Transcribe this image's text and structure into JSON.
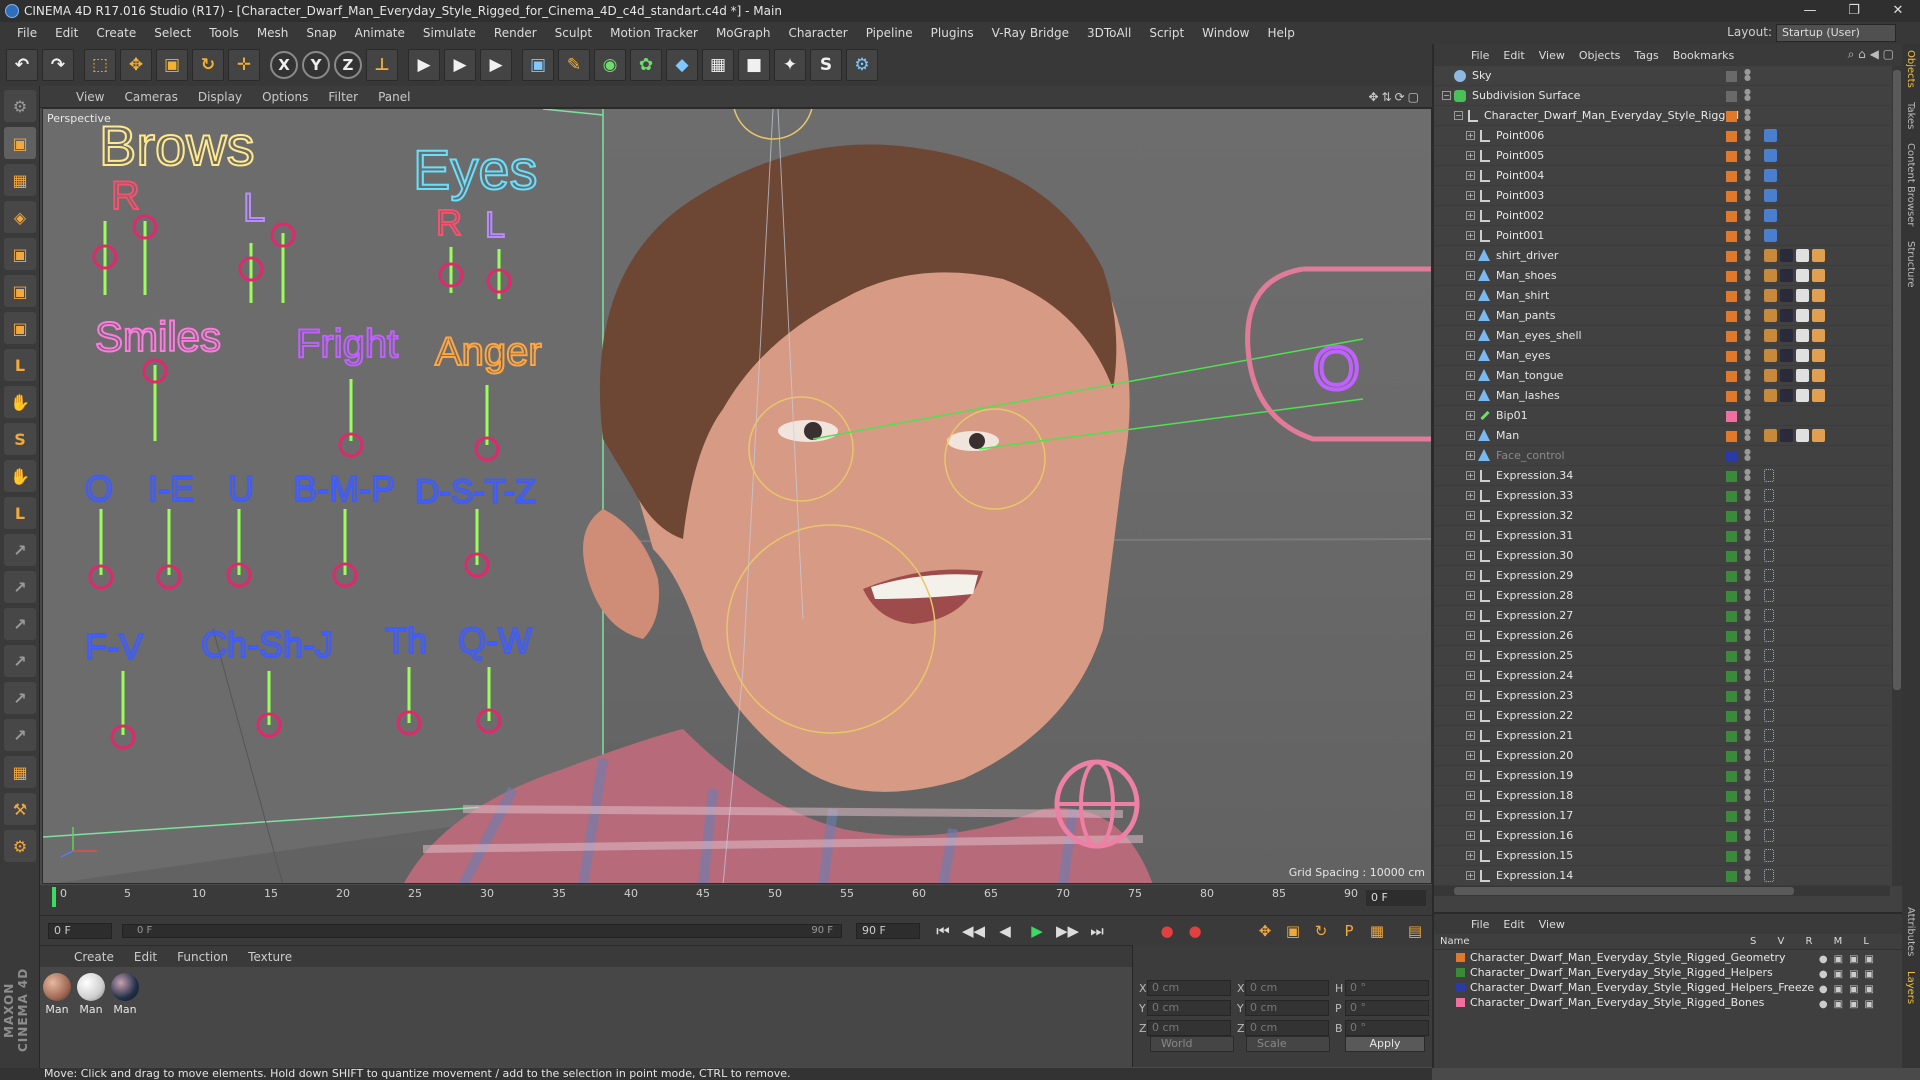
{
  "window": {
    "title": "CINEMA 4D R17.016 Studio (R17) - [Character_Dwarf_Man_Everyday_Style_Rigged_for_Cinema_4D_c4d_standart.c4d *] - Main",
    "controls": [
      "—",
      "❐",
      "✕"
    ]
  },
  "menu": [
    "File",
    "Edit",
    "Create",
    "Select",
    "Tools",
    "Mesh",
    "Snap",
    "Animate",
    "Simulate",
    "Render",
    "Sculpt",
    "Motion Tracker",
    "MoGraph",
    "Character",
    "Pipeline",
    "Plugins",
    "V-Ray Bridge",
    "3DToAll",
    "Script",
    "Window",
    "Help"
  ],
  "layout": {
    "label": "Layout:",
    "value": "Startup (User)"
  },
  "toolbar": {
    "undo": "↶",
    "redo": "↷",
    "select": "⬚",
    "move": "✥",
    "scale": "▣",
    "rotate": "↻",
    "move2": "✛",
    "axis_x": "X",
    "axis_y": "Y",
    "axis_z": "Z",
    "coord": "⊥",
    "render1": "▶",
    "render2": "▶",
    "render3": "▶",
    "cube": "▣",
    "pen": "✎",
    "nurbs": "◉",
    "array": "✿",
    "deform": "◆",
    "scene": "▦",
    "camera": "■",
    "light": "✦",
    "vray": "S",
    "python": "⚙"
  },
  "left_tools": [
    "⚙",
    "▣",
    "▦",
    "◈",
    "▣",
    "▣",
    "▣",
    "L",
    "✋",
    "S",
    "✋",
    "L",
    "↗",
    "↗",
    "↗",
    "↗",
    "↗",
    "↗",
    "▦",
    "⚒",
    "⚙"
  ],
  "viewport": {
    "menu": [
      "View",
      "Cameras",
      "Display",
      "Options",
      "Filter",
      "Panel"
    ],
    "label": "Perspective",
    "grid_spacing": "Grid Spacing : 10000 cm",
    "panel_labels": {
      "brows": "Brows",
      "eyes": "Eyes",
      "r1": "R",
      "l1": "L",
      "r2": "R",
      "l2": "L",
      "smiles": "Smiles",
      "fright": "Fright",
      "anger": "Anger",
      "o": "O",
      "ie": "I-E",
      "u": "U",
      "bmp": "B-M-P",
      "dstz": "D-S-T-Z",
      "fv": "F-V",
      "chshj": "Ch-Sh-J",
      "th": "Th",
      "qw": "Q-W",
      "eye_target": "O"
    },
    "colors": {
      "brows": "#ffe98a",
      "eyes": "#66e0ff",
      "r": "#ff4d6d",
      "l": "#b88cff",
      "smiles": "#ff7ae0",
      "fright": "#c060ff",
      "anger": "#ffa640",
      "viseme": "#3d5bff",
      "slider": "#9aff5a",
      "ring": "#e0286d"
    }
  },
  "timeline": {
    "ticks": [
      "0",
      "5",
      "10",
      "15",
      "20",
      "25",
      "30",
      "35",
      "40",
      "45",
      "50",
      "55",
      "60",
      "65",
      "70",
      "75",
      "80",
      "85",
      "90"
    ],
    "current_frame": "0 F",
    "start": "0 F",
    "slider_start": "0 F",
    "slider_end": "90 F",
    "end": "90 F"
  },
  "playback": [
    "⏮",
    "◀◀",
    "◀",
    "▶",
    "▶▶",
    "⏭"
  ],
  "materials": {
    "menu": [
      "Create",
      "Edit",
      "Function",
      "Texture"
    ],
    "items": [
      {
        "label": "Man",
        "color": "#a06a55"
      },
      {
        "label": "Man",
        "color": "#cfcfcf"
      },
      {
        "label": "Man",
        "color": "#22304a"
      }
    ]
  },
  "coordinates": {
    "pos": [
      {
        "axis": "X",
        "value": "0 cm"
      },
      {
        "axis": "Y",
        "value": "0 cm"
      },
      {
        "axis": "Z",
        "value": "0 cm"
      }
    ],
    "size": [
      {
        "axis": "X",
        "value": "0 cm"
      },
      {
        "axis": "Y",
        "value": "0 cm"
      },
      {
        "axis": "Z",
        "value": "0 cm"
      }
    ],
    "rot": [
      {
        "axis": "H",
        "value": "0 °"
      },
      {
        "axis": "P",
        "value": "0 °"
      },
      {
        "axis": "B",
        "value": "0 °"
      }
    ],
    "mode1": "World",
    "mode2": "Scale",
    "apply": "Apply"
  },
  "status": "Move: Click and drag to move elements. Hold down SHIFT to quantize movement / add to the selection in point mode, CTRL to remove.",
  "objects": {
    "menu": [
      "File",
      "Edit",
      "View",
      "Objects",
      "Tags",
      "Bookmarks"
    ],
    "rows": [
      {
        "name": "Sky",
        "indent": 0,
        "type": "sky",
        "layer": "",
        "tags": ""
      },
      {
        "name": "Subdivision Surface",
        "indent": 0,
        "type": "subd",
        "layer": "",
        "tags": ""
      },
      {
        "name": "Character_Dwarf_Man_Everyday_Style_Rigged",
        "indent": 1,
        "type": "null",
        "layer": "#e07a2a",
        "tags": ""
      },
      {
        "name": "Point006",
        "indent": 2,
        "type": "null",
        "layer": "#e07a2a",
        "tags": "p"
      },
      {
        "name": "Point005",
        "indent": 2,
        "type": "null",
        "layer": "#e07a2a",
        "tags": "p"
      },
      {
        "name": "Point004",
        "indent": 2,
        "type": "null",
        "layer": "#e07a2a",
        "tags": "p"
      },
      {
        "name": "Point003",
        "indent": 2,
        "type": "null",
        "layer": "#e07a2a",
        "tags": "p"
      },
      {
        "name": "Point002",
        "indent": 2,
        "type": "null",
        "layer": "#e07a2a",
        "tags": "p"
      },
      {
        "name": "Point001",
        "indent": 2,
        "type": "null",
        "layer": "#e07a2a",
        "tags": "p"
      },
      {
        "name": "shirt_driver",
        "indent": 2,
        "type": "mesh",
        "layer": "#e07a2a",
        "tags": "m"
      },
      {
        "name": "Man_shoes",
        "indent": 2,
        "type": "mesh",
        "layer": "#e07a2a",
        "tags": "m"
      },
      {
        "name": "Man_shirt",
        "indent": 2,
        "type": "mesh",
        "layer": "#e07a2a",
        "tags": "m"
      },
      {
        "name": "Man_pants",
        "indent": 2,
        "type": "mesh",
        "layer": "#e07a2a",
        "tags": "m"
      },
      {
        "name": "Man_eyes_shell",
        "indent": 2,
        "type": "mesh",
        "layer": "#e07a2a",
        "tags": "m"
      },
      {
        "name": "Man_eyes",
        "indent": 2,
        "type": "mesh",
        "layer": "#e07a2a",
        "tags": "m"
      },
      {
        "name": "Man_tongue",
        "indent": 2,
        "type": "mesh",
        "layer": "#e07a2a",
        "tags": "m"
      },
      {
        "name": "Man_lashes",
        "indent": 2,
        "type": "mesh",
        "layer": "#e07a2a",
        "tags": "m"
      },
      {
        "name": "Bip01",
        "indent": 2,
        "type": "bone",
        "layer": "#f06fa0",
        "tags": ""
      },
      {
        "name": "Man",
        "indent": 2,
        "type": "mesh",
        "layer": "#e07a2a",
        "tags": "m"
      },
      {
        "name": "Face_control",
        "indent": 2,
        "type": "mesh",
        "layer": "#2a3aa8",
        "tags": "",
        "dim": true
      },
      {
        "name": "Expression.34",
        "indent": 2,
        "type": "null",
        "layer": "#3a8a3a",
        "tags": "e"
      },
      {
        "name": "Expression.33",
        "indent": 2,
        "type": "null",
        "layer": "#3a8a3a",
        "tags": "e"
      },
      {
        "name": "Expression.32",
        "indent": 2,
        "type": "null",
        "layer": "#3a8a3a",
        "tags": "e"
      },
      {
        "name": "Expression.31",
        "indent": 2,
        "type": "null",
        "layer": "#3a8a3a",
        "tags": "e"
      },
      {
        "name": "Expression.30",
        "indent": 2,
        "type": "null",
        "layer": "#3a8a3a",
        "tags": "e"
      },
      {
        "name": "Expression.29",
        "indent": 2,
        "type": "null",
        "layer": "#3a8a3a",
        "tags": "e"
      },
      {
        "name": "Expression.28",
        "indent": 2,
        "type": "null",
        "layer": "#3a8a3a",
        "tags": "e"
      },
      {
        "name": "Expression.27",
        "indent": 2,
        "type": "null",
        "layer": "#3a8a3a",
        "tags": "e"
      },
      {
        "name": "Expression.26",
        "indent": 2,
        "type": "null",
        "layer": "#3a8a3a",
        "tags": "e"
      },
      {
        "name": "Expression.25",
        "indent": 2,
        "type": "null",
        "layer": "#3a8a3a",
        "tags": "e"
      },
      {
        "name": "Expression.24",
        "indent": 2,
        "type": "null",
        "layer": "#3a8a3a",
        "tags": "e"
      },
      {
        "name": "Expression.23",
        "indent": 2,
        "type": "null",
        "layer": "#3a8a3a",
        "tags": "e"
      },
      {
        "name": "Expression.22",
        "indent": 2,
        "type": "null",
        "layer": "#3a8a3a",
        "tags": "e"
      },
      {
        "name": "Expression.21",
        "indent": 2,
        "type": "null",
        "layer": "#3a8a3a",
        "tags": "e"
      },
      {
        "name": "Expression.20",
        "indent": 2,
        "type": "null",
        "layer": "#3a8a3a",
        "tags": "e"
      },
      {
        "name": "Expression.19",
        "indent": 2,
        "type": "null",
        "layer": "#3a8a3a",
        "tags": "e"
      },
      {
        "name": "Expression.18",
        "indent": 2,
        "type": "null",
        "layer": "#3a8a3a",
        "tags": "e"
      },
      {
        "name": "Expression.17",
        "indent": 2,
        "type": "null",
        "layer": "#3a8a3a",
        "tags": "e"
      },
      {
        "name": "Expression.16",
        "indent": 2,
        "type": "null",
        "layer": "#3a8a3a",
        "tags": "e"
      },
      {
        "name": "Expression.15",
        "indent": 2,
        "type": "null",
        "layer": "#3a8a3a",
        "tags": "e"
      },
      {
        "name": "Expression.14",
        "indent": 2,
        "type": "null",
        "layer": "#3a8a3a",
        "tags": "e"
      }
    ]
  },
  "layers": {
    "menu": [
      "File",
      "Edit",
      "View"
    ],
    "header": {
      "name": "Name",
      "cols": "S V R M L"
    },
    "rows": [
      {
        "name": "Character_Dwarf_Man_Everyday_Style_Rigged_Geometry",
        "color": "#e07a2a"
      },
      {
        "name": "Character_Dwarf_Man_Everyday_Style_Rigged_Helpers",
        "color": "#3a8a3a"
      },
      {
        "name": "Character_Dwarf_Man_Everyday_Style_Rigged_Helpers_Freeze",
        "color": "#2a3aa8"
      },
      {
        "name": "Character_Dwarf_Man_Everyday_Style_Rigged_Bones",
        "color": "#f06fa0"
      }
    ]
  },
  "side_tabs": [
    "Objects",
    "Takes",
    "Content Browser",
    "Structure",
    "Attributes",
    "Layers"
  ]
}
